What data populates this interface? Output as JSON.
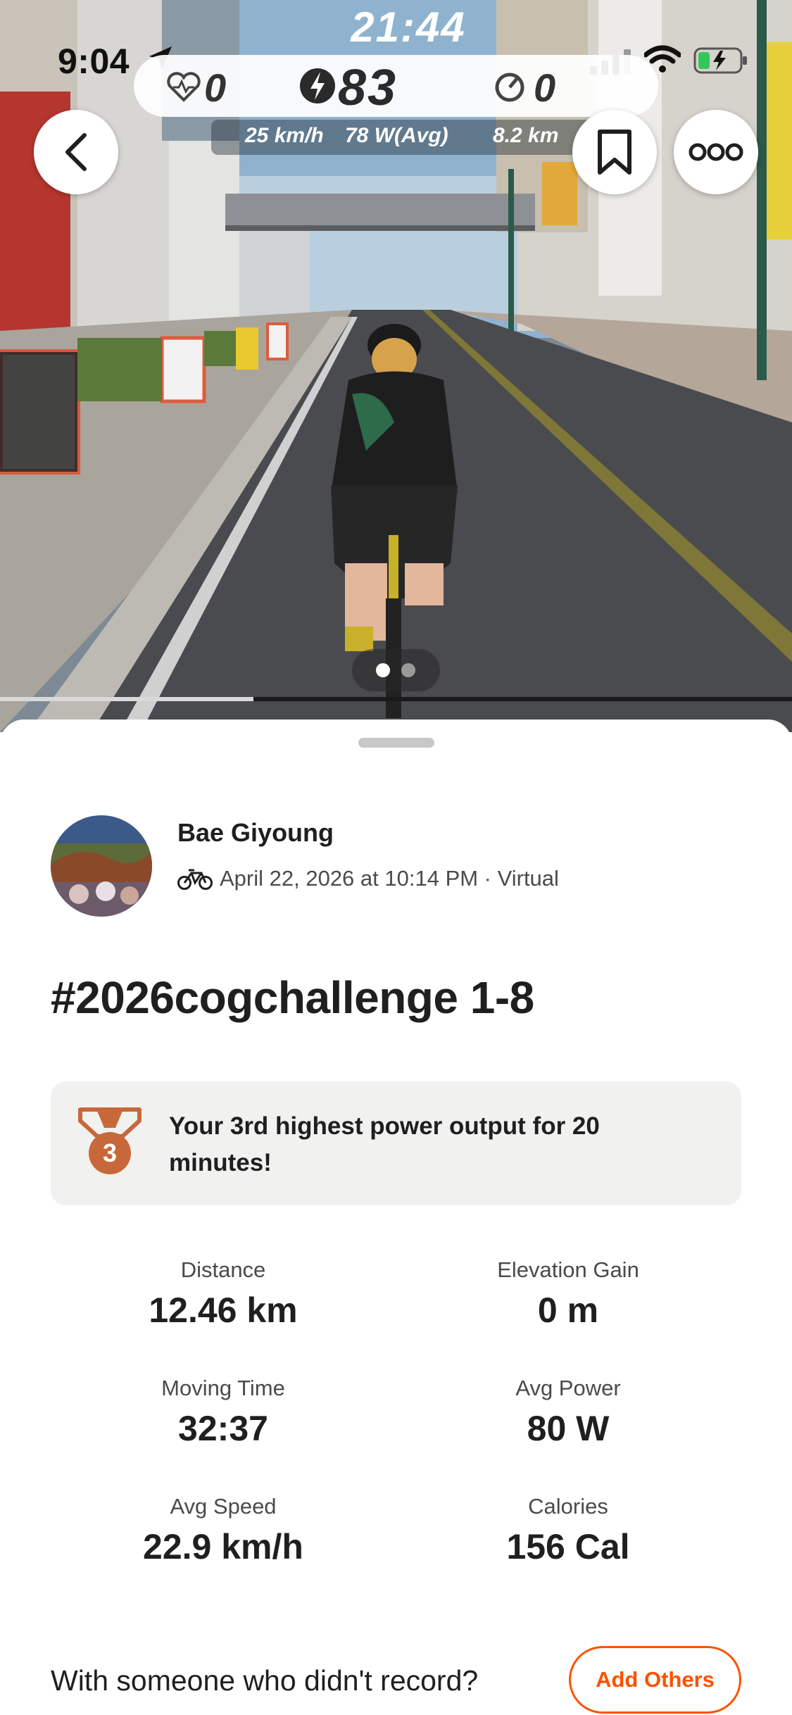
{
  "status_bar": {
    "time": "9:04",
    "location_icon": "location-arrow-icon",
    "signal_icon": "cellular-signal-icon",
    "wifi_icon": "wifi-icon",
    "battery_icon": "battery-charging-icon"
  },
  "game_hud": {
    "elapsed_time": "21:44",
    "heart_rate": "0",
    "power": "83",
    "cadence": "0",
    "speed": "25 km/h",
    "avg_power": "78 W(Avg)",
    "distance": "8.2 km"
  },
  "media": {
    "page_count": 2,
    "current_page": 1,
    "video_progress": 0.32
  },
  "nav": {
    "back_icon": "chevron-left-icon",
    "bookmark_icon": "bookmark-icon",
    "more_icon": "more-dots-icon"
  },
  "activity": {
    "athlete_name": "Bae Giyoung",
    "sport_icon": "bike-icon",
    "date_line": "April 22, 2026 at 10:14 PM · Virtual",
    "title": "#2026cogchallenge 1-8",
    "achievement": {
      "medal_rank": "3",
      "text": "Your 3rd highest power output for 20 minutes!"
    },
    "stats": [
      {
        "label": "Distance",
        "value": "12.46 km"
      },
      {
        "label": "Elevation Gain",
        "value": "0 m"
      },
      {
        "label": "Moving Time",
        "value": "32:37"
      },
      {
        "label": "Avg Power",
        "value": "80 W"
      },
      {
        "label": "Avg Speed",
        "value": "22.9 km/h"
      },
      {
        "label": "Calories",
        "value": "156 Cal"
      }
    ],
    "record_prompt": "With someone who didn't record?",
    "add_others_label": "Add Others"
  },
  "colors": {
    "accent": "#fc5200",
    "medal": "#c8683a",
    "card_bg": "#f1f1f0"
  }
}
